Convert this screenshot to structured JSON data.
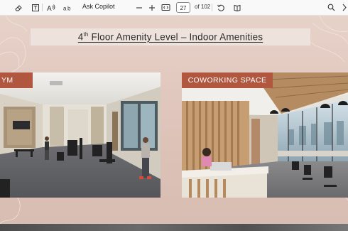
{
  "toolbar": {
    "ask_copilot": "Ask Copilot",
    "current_page": "27",
    "page_total": "of 102",
    "icons": [
      "eraser-icon",
      "text-box-icon",
      "read-aloud-icon",
      "translate-icon",
      "zoom-out-icon",
      "zoom-in-icon",
      "fit-page-icon",
      "rotate-icon",
      "page-view-icon",
      "search-icon",
      "more-icon"
    ]
  },
  "document": {
    "title_prefix": "4",
    "title_sup": "th",
    "title_rest": " Floor Amenity Level – Indoor Amenities",
    "gym_label": "YM",
    "coworking_label": "COWORKING SPACE"
  },
  "colors": {
    "page_bg": "#e2cbc2",
    "title_band": "#eee2dc",
    "label_bg": "#b2573f",
    "toolbar_bg": "#f9f9f9"
  }
}
